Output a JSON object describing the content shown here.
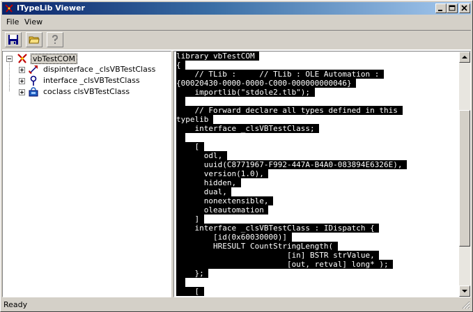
{
  "window": {
    "title": "ITypeLib Viewer"
  },
  "menu": {
    "file": "File",
    "view": "View"
  },
  "toolbar": {
    "save_icon": "floppy-disk-icon",
    "open_icon": "folder-icon",
    "help_icon": "help-icon"
  },
  "tree": {
    "root": {
      "label": "vbTestCOM",
      "icon": "typelib-icon"
    },
    "children": [
      {
        "label": "dispinterface _clsVBTestClass",
        "icon": "dispinterface-icon"
      },
      {
        "label": "interface _clsVBTestClass",
        "icon": "interface-icon"
      },
      {
        "label": "coclass clsVBTestClass",
        "icon": "coclass-icon"
      }
    ]
  },
  "code": {
    "lines": [
      "library vbTestCOM",
      "{",
      "    // TLib :     // TLib : OLE Automation :",
      "{00020430-0000-0000-C000-000000000046}",
      "    importlib(\"stdole2.tlb\");",
      "",
      "    // Forward declare all types defined in this",
      "typelib",
      "    interface _clsVBTestClass;",
      "",
      "    [",
      "      odl,",
      "      uuid(C8771967-F992-447A-B4A0-083894E6326E),",
      "      version(1.0),",
      "      hidden,",
      "      dual,",
      "      nonextensible,",
      "      oleautomation",
      "    ]",
      "    interface _clsVBTestClass : IDispatch {",
      "        [id(0x60030000)]",
      "        HRESULT CountStringLength(",
      "                        [in] BSTR strValue,",
      "                        [out, retval] long* );",
      "    };",
      "",
      "    ["
    ]
  },
  "status": {
    "text": "Ready"
  }
}
